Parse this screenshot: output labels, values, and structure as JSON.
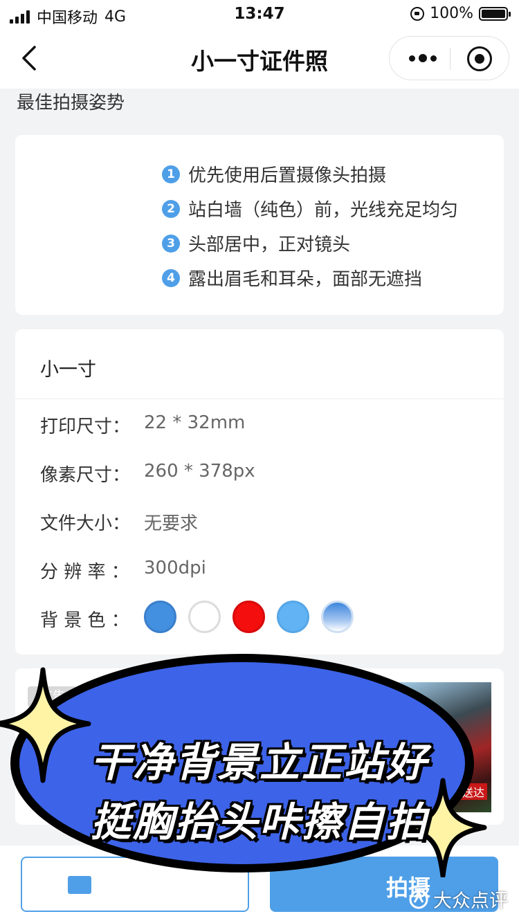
{
  "status_bar": {
    "carrier": "中国移动",
    "network": "4G",
    "time": "13:47",
    "battery": "100%"
  },
  "nav": {
    "title": "小一寸证件照"
  },
  "tips_section": {
    "title": "最佳拍摄姿势",
    "items": [
      {
        "num": "1",
        "text": "优先使用后置摄像头拍摄"
      },
      {
        "num": "2",
        "text": "站白墙（纯色）前，光线充足均匀"
      },
      {
        "num": "3",
        "text": "头部居中，正对镜头"
      },
      {
        "num": "4",
        "text": "露出眉毛和耳朵，面部无遮挡"
      }
    ]
  },
  "spec": {
    "title": "小一寸",
    "rows": [
      {
        "label": "打印尺寸：",
        "value": "22 * 32mm"
      },
      {
        "label": "像素尺寸：",
        "value": "260 * 378px"
      },
      {
        "label": "文件大小：",
        "value": "无要求"
      },
      {
        "label": "分 辨 率 ：",
        "value": "300dpi"
      }
    ],
    "background_label": "背 景 色 ：",
    "colors": [
      "#438fe0",
      "#ffffff",
      "#f50e0e",
      "#62b3f3",
      "gradient-blue"
    ]
  },
  "ad": {
    "badge": "广告",
    "image_label": "神送达"
  },
  "bottom": {
    "shoot_label": "拍摄"
  },
  "sticker": {
    "line1": "干净背景立正站好",
    "line2": "挺胸抬头咔擦自拍"
  },
  "watermark": {
    "text": "大众点评"
  },
  "colors": {
    "accent": "#4f9fe8",
    "background": "#f2f3f5"
  }
}
